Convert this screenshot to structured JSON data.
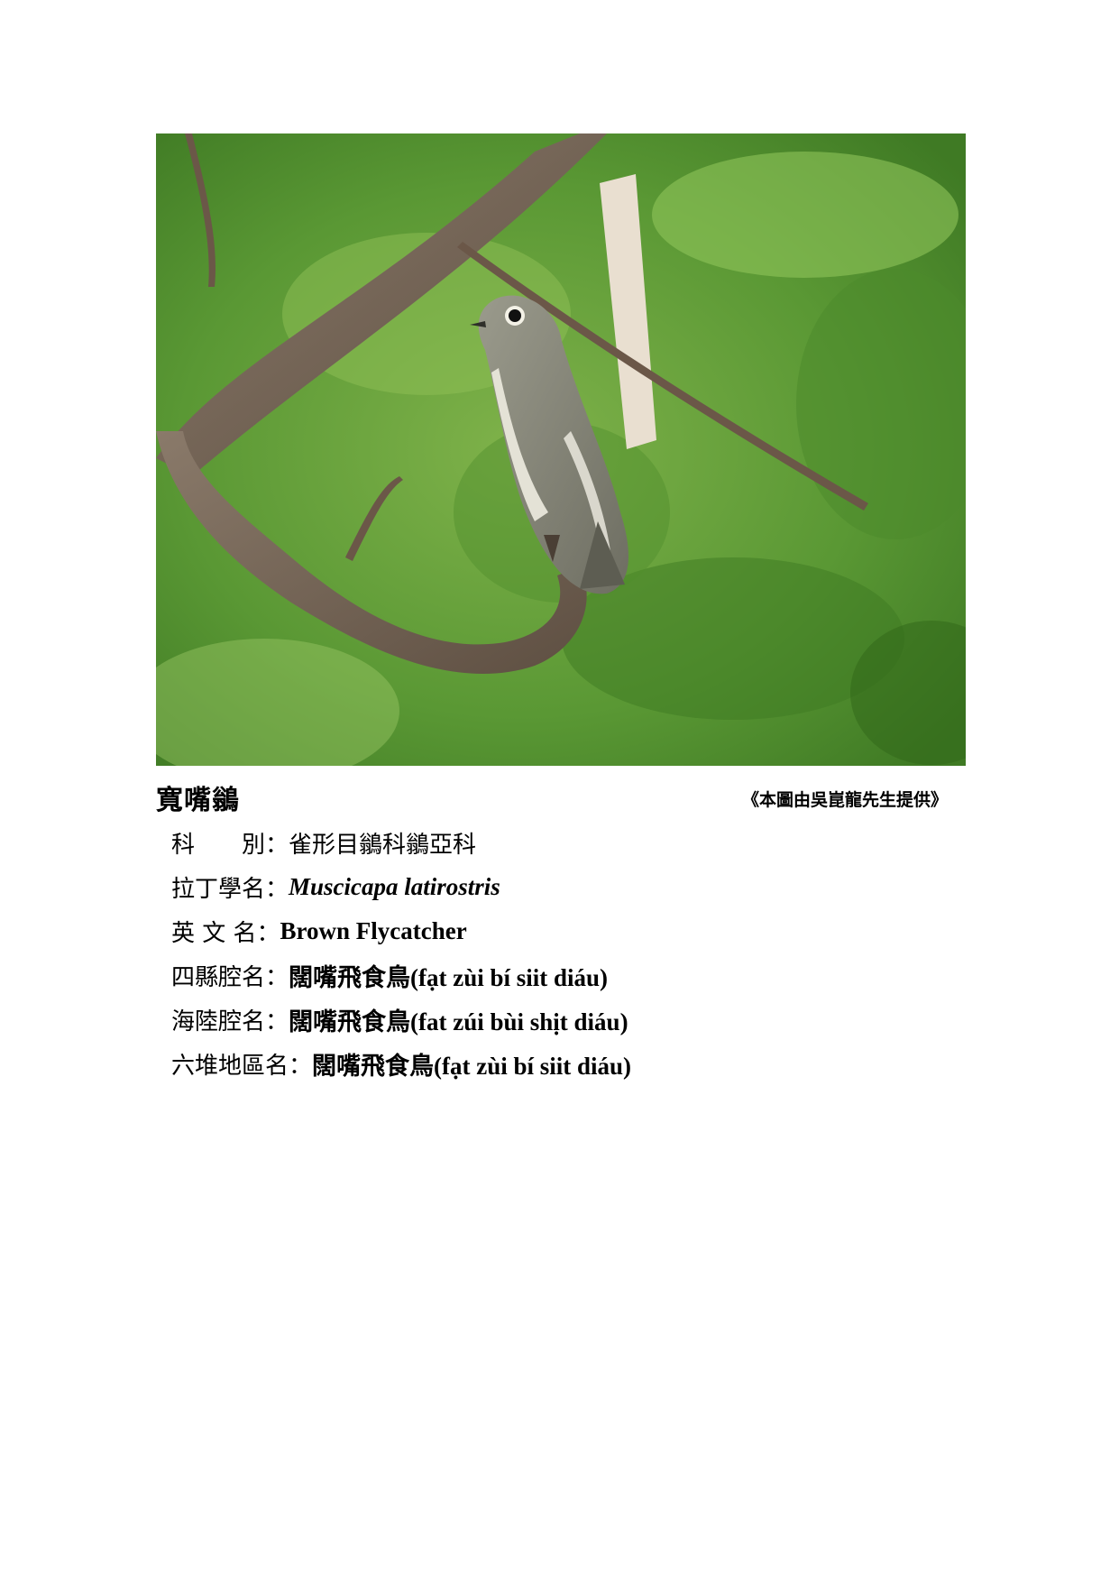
{
  "photo": {
    "alt": "bird perched on branch"
  },
  "title": "寬嘴鶲",
  "credit": "《本圖由吳崑龍先生提供》",
  "info": [
    {
      "label": "科　　別：",
      "value": "雀形目鶲科鶲亞科",
      "style": "cjk"
    },
    {
      "label": "拉丁學名：",
      "value": "Muscicapa latirostris",
      "style": "italic"
    },
    {
      "label": "英 文 名：",
      "value": "Brown Flycatcher",
      "style": "bold"
    },
    {
      "label": "四縣腔名：",
      "value": "闊嘴飛食鳥(fạt zùi bí siit diáu)",
      "style": "bold"
    },
    {
      "label": "海陸腔名：",
      "value": "闊嘴飛食鳥(fat zúi bùi shịt diáu)",
      "style": "bold"
    },
    {
      "label": "六堆地區名：",
      "value": "闊嘴飛食鳥(fạt zùi bí siit diáu)",
      "style": "bold"
    }
  ]
}
